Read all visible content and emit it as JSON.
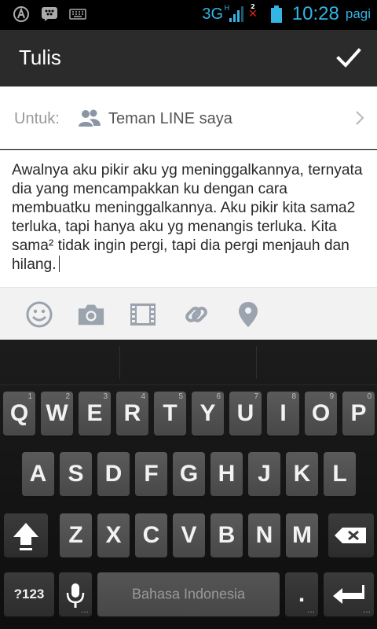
{
  "status_bar": {
    "network": "3G",
    "network_sub": "H",
    "sim_slot": "2",
    "time": "10:28",
    "ampm": "pagi"
  },
  "action_bar": {
    "title": "Tulis",
    "confirm_icon": "check-icon"
  },
  "recipient": {
    "label": "Untuk:",
    "value": "Teman LINE saya",
    "icon": "friends-icon"
  },
  "compose": {
    "text": "Awalnya aku pikir aku yg meninggalkannya, ternyata dia yang mencampakkan ku dengan cara membuatku meninggalkannya. Aku pikir kita sama2 terluka, tapi hanya aku yg menangis terluka. Kita sama² tidak ingin pergi, tapi dia pergi menjauh dan hilang."
  },
  "attachments": [
    {
      "name": "emoji-icon"
    },
    {
      "name": "camera-icon"
    },
    {
      "name": "video-icon"
    },
    {
      "name": "link-icon"
    },
    {
      "name": "location-icon"
    }
  ],
  "keyboard": {
    "row1": [
      {
        "k": "Q",
        "h": "1"
      },
      {
        "k": "W",
        "h": "2"
      },
      {
        "k": "E",
        "h": "3"
      },
      {
        "k": "R",
        "h": "4"
      },
      {
        "k": "T",
        "h": "5"
      },
      {
        "k": "Y",
        "h": "6"
      },
      {
        "k": "U",
        "h": "7"
      },
      {
        "k": "I",
        "h": "8"
      },
      {
        "k": "O",
        "h": "9"
      },
      {
        "k": "P",
        "h": "0"
      }
    ],
    "row2": [
      "A",
      "S",
      "D",
      "F",
      "G",
      "H",
      "J",
      "K",
      "L"
    ],
    "row3": [
      "Z",
      "X",
      "C",
      "V",
      "B",
      "N",
      "M"
    ],
    "symbols_label": "?123",
    "space_label": "Bahasa Indonesia",
    "period_label": ".",
    "colors": {
      "accent": "#33b5e5",
      "key": "#505050",
      "keyboard_bg": "#151515"
    }
  }
}
